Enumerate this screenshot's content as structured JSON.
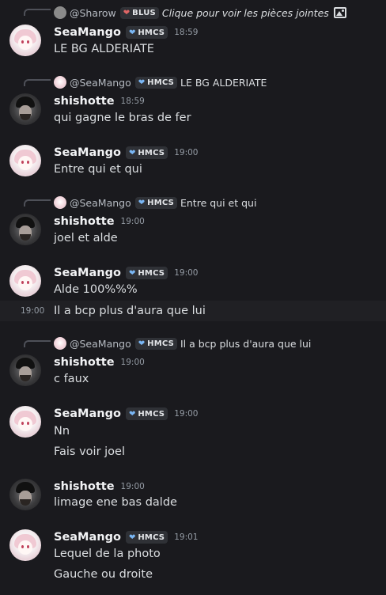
{
  "messages": [
    {
      "reply": {
        "user": "@Sharow",
        "tag": "BLUS",
        "tag_color": "#e06666",
        "text": "Clique pour voir les pièces jointes",
        "has_image_icon": true
      },
      "user": "SeaMango",
      "tag": "HMCS",
      "time": "18:59",
      "lines": [
        "LE BG ALDERIATE"
      ]
    },
    {
      "reply": {
        "user": "@SeaMango",
        "tag": "HMCS",
        "text": "LE BG ALDERIATE"
      },
      "user": "shishotte",
      "time": "18:59",
      "lines": [
        "qui gagne le bras de fer"
      ]
    },
    {
      "user": "SeaMango",
      "tag": "HMCS",
      "time": "19:00",
      "lines": [
        "Entre qui et qui"
      ]
    },
    {
      "reply": {
        "user": "@SeaMango",
        "tag": "HMCS",
        "text": "Entre qui et qui"
      },
      "user": "shishotte",
      "time": "19:00",
      "lines": [
        "joel et alde"
      ]
    },
    {
      "user": "SeaMango",
      "tag": "HMCS",
      "time": "19:00",
      "lines": [
        "Alde 100%%%"
      ],
      "followup": {
        "time": "19:00",
        "text": "Il a bcp plus d'aura que lui"
      }
    },
    {
      "reply": {
        "user": "@SeaMango",
        "tag": "HMCS",
        "text": "Il a bcp plus d'aura que lui"
      },
      "user": "shishotte",
      "time": "19:00",
      "lines": [
        "c faux"
      ]
    },
    {
      "user": "SeaMango",
      "tag": "HMCS",
      "time": "19:00",
      "lines": [
        "Nn",
        "Fais voir joel"
      ]
    },
    {
      "user": "shishotte",
      "time": "19:00",
      "lines": [
        "limage ene bas dalde"
      ]
    },
    {
      "user": "SeaMango",
      "tag": "HMCS",
      "time": "19:01",
      "lines": [
        "Lequel de la photo",
        "Gauche ou droite"
      ]
    }
  ],
  "colors": {
    "background": "#1a1a1e",
    "hover_row": "#202024",
    "username": "#f2f3f5",
    "message_text": "#dbdee1",
    "timestamp": "#949ba4",
    "hmcs_heart": "#7ab7f5",
    "blus_heart": "#e06666"
  },
  "icons": {
    "tag_heart": "heart-icon",
    "attachment": "image-icon"
  }
}
